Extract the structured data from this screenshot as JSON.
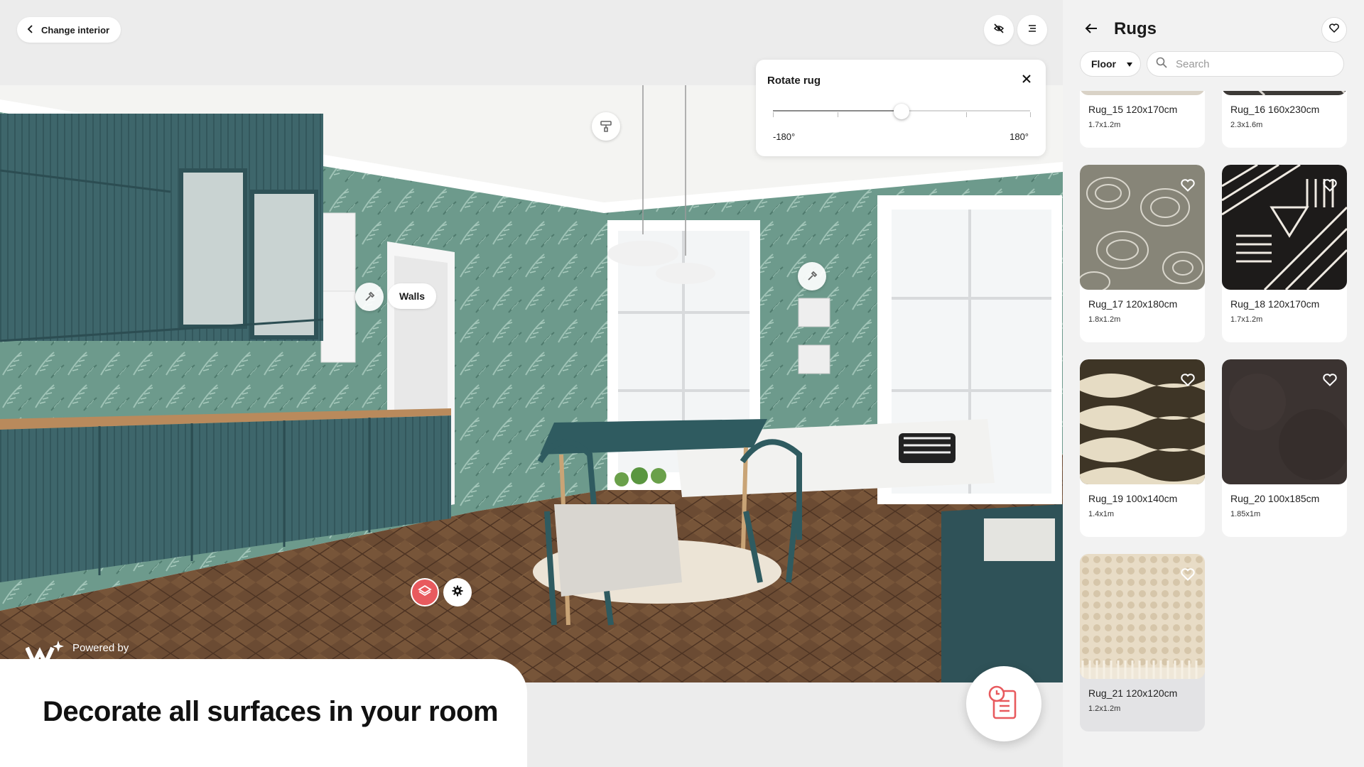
{
  "top_bar": {
    "change_interior_label": "Change interior"
  },
  "rotate_panel": {
    "title": "Rotate rug",
    "min_label": "-180°",
    "max_label": "180°",
    "value_fraction": 0.5
  },
  "scene": {
    "walls_label": "Walls",
    "powered_by_label": "Powered by"
  },
  "promo": {
    "headline": "Decorate all surfaces in your room"
  },
  "sidebar": {
    "title": "Rugs",
    "filter_label": "Floor",
    "search_placeholder": "Search",
    "items": [
      {
        "name": "Rug_15 120x170cm",
        "size": "1.7x1.2m",
        "pattern": "light",
        "selected": false
      },
      {
        "name": "Rug_16 160x230cm",
        "size": "2.3x1.6m",
        "pattern": "darkgeo",
        "selected": false
      },
      {
        "name": "Rug_17 120x180cm",
        "size": "1.8x1.2m",
        "pattern": "swirl",
        "selected": false
      },
      {
        "name": "Rug_18 120x170cm",
        "size": "1.7x1.2m",
        "pattern": "lines",
        "selected": false
      },
      {
        "name": "Rug_19 100x140cm",
        "size": "1.4x1m",
        "pattern": "waves",
        "selected": false
      },
      {
        "name": "Rug_20 100x185cm",
        "size": "1.85x1m",
        "pattern": "dark",
        "selected": false
      },
      {
        "name": "Rug_21 120x120cm",
        "size": "1.2x1.2m",
        "pattern": "knit",
        "selected": true
      }
    ]
  },
  "colors": {
    "accent": "#e85a5e",
    "wall": "#5e8a7e",
    "cabinet": "#3a6065",
    "floor": "#6a4a33"
  }
}
